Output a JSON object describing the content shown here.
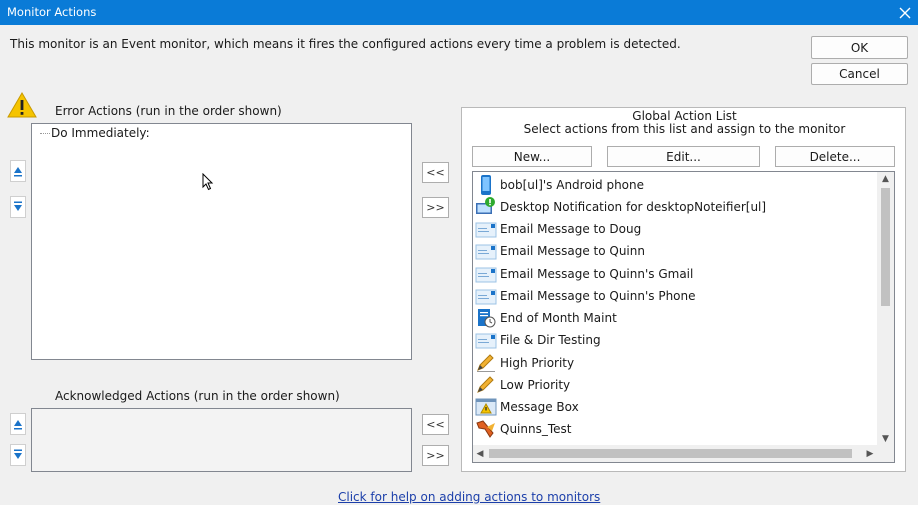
{
  "window": {
    "title": "Monitor Actions"
  },
  "description": "This monitor is an Event monitor, which means it fires the configured actions every time a problem is detected.",
  "buttons": {
    "ok": "OK",
    "cancel": "Cancel"
  },
  "error_actions": {
    "label": "Error Actions (run in the order shown)",
    "items": [
      "Do Immediately:"
    ]
  },
  "acknowledged_actions": {
    "label": "Acknowledged Actions (run in the order shown)"
  },
  "move": {
    "left": "<<",
    "right": ">>"
  },
  "global": {
    "title": "Global Action List",
    "subtitle": "Select actions from this list and assign to the monitor",
    "new_label": "New...",
    "edit_label": "Edit...",
    "delete_label": "Delete...",
    "actions": [
      {
        "label": "bob[ul]'s Android phone",
        "icon": "phone-icon"
      },
      {
        "label": "Desktop Notification for desktopNoteifier[ul]",
        "icon": "desktop-notification-icon"
      },
      {
        "label": "Email Message to Doug",
        "icon": "email-icon"
      },
      {
        "label": "Email Message to Quinn",
        "icon": "email-icon"
      },
      {
        "label": "Email Message to Quinn's Gmail",
        "icon": "email-icon"
      },
      {
        "label": "Email Message to Quinn's Phone",
        "icon": "email-icon"
      },
      {
        "label": "End of Month Maint",
        "icon": "scheduled-task-icon"
      },
      {
        "label": "File & Dir Testing",
        "icon": "email-icon"
      },
      {
        "label": "High Priority",
        "icon": "pencil-icon"
      },
      {
        "label": "Low Priority",
        "icon": "pencil-icon"
      },
      {
        "label": "Message Box",
        "icon": "message-box-icon"
      },
      {
        "label": "Quinns_Test",
        "icon": "wrench-icon"
      }
    ]
  },
  "help_link": "Click for help on adding actions to monitors",
  "colors": {
    "titlebar": "#0a7bd7",
    "link": "#1c3faa",
    "warning": "#f5c400"
  }
}
